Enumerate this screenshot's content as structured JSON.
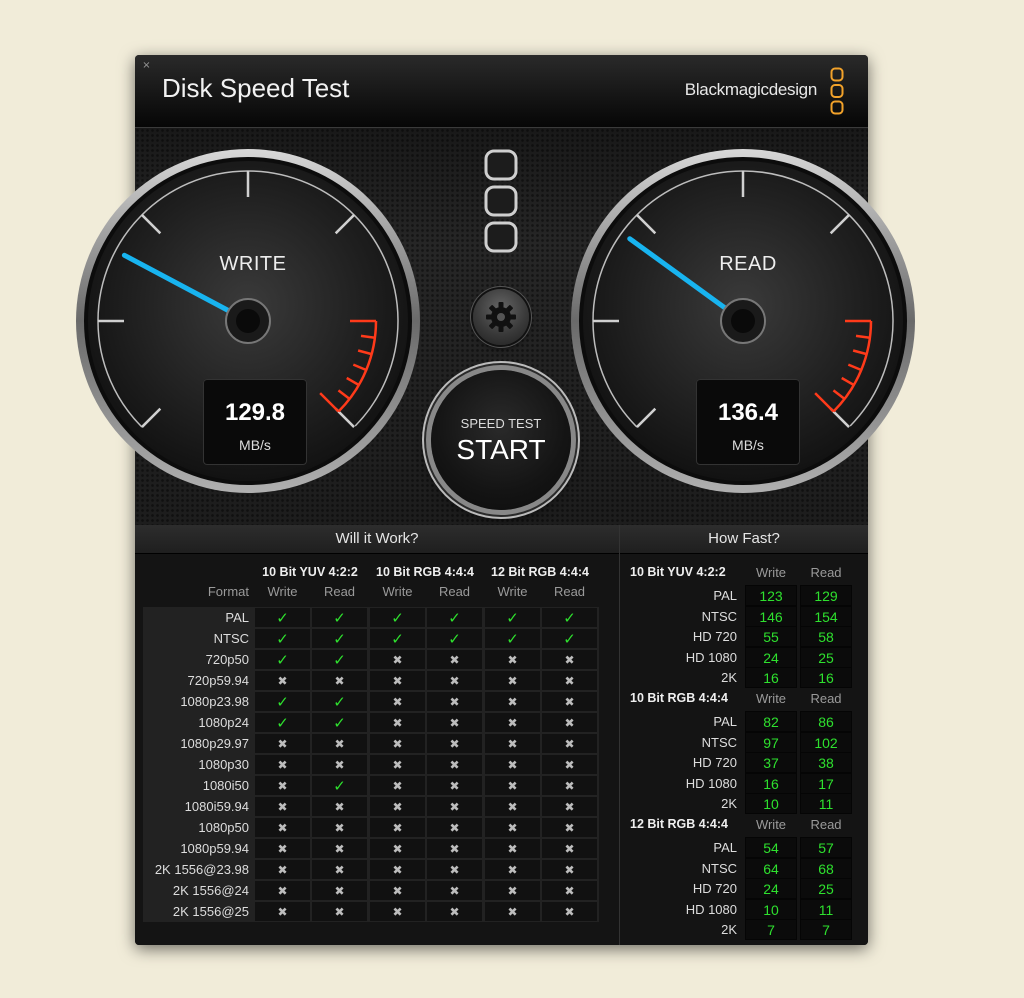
{
  "window": {
    "close_glyph": "×",
    "title": "Disk Speed Test",
    "brand": "Blackmagicdesign",
    "accent_color": "#f2a22a"
  },
  "gauges": {
    "write": {
      "label": "WRITE",
      "value": "129.8",
      "unit": "MB/s",
      "needle_angle_deg": -62
    },
    "read": {
      "label": "READ",
      "value": "136.4",
      "unit": "MB/s",
      "needle_angle_deg": -54
    }
  },
  "start_button": {
    "top_label": "SPEED TEST",
    "main_label": "START"
  },
  "will_it_work": {
    "title": "Will it Work?",
    "format_header": "Format",
    "groups": [
      {
        "name": "10 Bit YUV 4:2:2",
        "cols": [
          "Write",
          "Read"
        ]
      },
      {
        "name": "10 Bit RGB 4:4:4",
        "cols": [
          "Write",
          "Read"
        ]
      },
      {
        "name": "12 Bit RGB 4:4:4",
        "cols": [
          "Write",
          "Read"
        ]
      }
    ],
    "rows": [
      {
        "format": "PAL",
        "results": [
          true,
          true,
          true,
          true,
          true,
          true
        ]
      },
      {
        "format": "NTSC",
        "results": [
          true,
          true,
          true,
          true,
          true,
          true
        ]
      },
      {
        "format": "720p50",
        "results": [
          true,
          true,
          false,
          false,
          false,
          false
        ]
      },
      {
        "format": "720p59.94",
        "results": [
          false,
          false,
          false,
          false,
          false,
          false
        ]
      },
      {
        "format": "1080p23.98",
        "results": [
          true,
          true,
          false,
          false,
          false,
          false
        ]
      },
      {
        "format": "1080p24",
        "results": [
          true,
          true,
          false,
          false,
          false,
          false
        ]
      },
      {
        "format": "1080p29.97",
        "results": [
          false,
          false,
          false,
          false,
          false,
          false
        ]
      },
      {
        "format": "1080p30",
        "results": [
          false,
          false,
          false,
          false,
          false,
          false
        ]
      },
      {
        "format": "1080i50",
        "results": [
          false,
          true,
          false,
          false,
          false,
          false
        ]
      },
      {
        "format": "1080i59.94",
        "results": [
          false,
          false,
          false,
          false,
          false,
          false
        ]
      },
      {
        "format": "1080p50",
        "results": [
          false,
          false,
          false,
          false,
          false,
          false
        ]
      },
      {
        "format": "1080p59.94",
        "results": [
          false,
          false,
          false,
          false,
          false,
          false
        ]
      },
      {
        "format": "2K 1556@23.98",
        "results": [
          false,
          false,
          false,
          false,
          false,
          false
        ]
      },
      {
        "format": "2K 1556@24",
        "results": [
          false,
          false,
          false,
          false,
          false,
          false
        ]
      },
      {
        "format": "2K 1556@25",
        "results": [
          false,
          false,
          false,
          false,
          false,
          false
        ]
      }
    ],
    "check_glyph": "✓",
    "cross_glyph": "✖"
  },
  "how_fast": {
    "title": "How Fast?",
    "col_write": "Write",
    "col_read": "Read",
    "sections": [
      {
        "name": "10 Bit YUV 4:2:2",
        "rows": [
          {
            "format": "PAL",
            "write": "123",
            "read": "129"
          },
          {
            "format": "NTSC",
            "write": "146",
            "read": "154"
          },
          {
            "format": "HD 720",
            "write": "55",
            "read": "58"
          },
          {
            "format": "HD 1080",
            "write": "24",
            "read": "25"
          },
          {
            "format": "2K",
            "write": "16",
            "read": "16"
          }
        ]
      },
      {
        "name": "10 Bit RGB 4:4:4",
        "rows": [
          {
            "format": "PAL",
            "write": "82",
            "read": "86"
          },
          {
            "format": "NTSC",
            "write": "97",
            "read": "102"
          },
          {
            "format": "HD 720",
            "write": "37",
            "read": "38"
          },
          {
            "format": "HD 1080",
            "write": "16",
            "read": "17"
          },
          {
            "format": "2K",
            "write": "10",
            "read": "11"
          }
        ]
      },
      {
        "name": "12 Bit RGB 4:4:4",
        "rows": [
          {
            "format": "PAL",
            "write": "54",
            "read": "57"
          },
          {
            "format": "NTSC",
            "write": "64",
            "read": "68"
          },
          {
            "format": "HD 720",
            "write": "24",
            "read": "25"
          },
          {
            "format": "HD 1080",
            "write": "10",
            "read": "11"
          },
          {
            "format": "2K",
            "write": "7",
            "read": "7"
          }
        ]
      }
    ]
  }
}
